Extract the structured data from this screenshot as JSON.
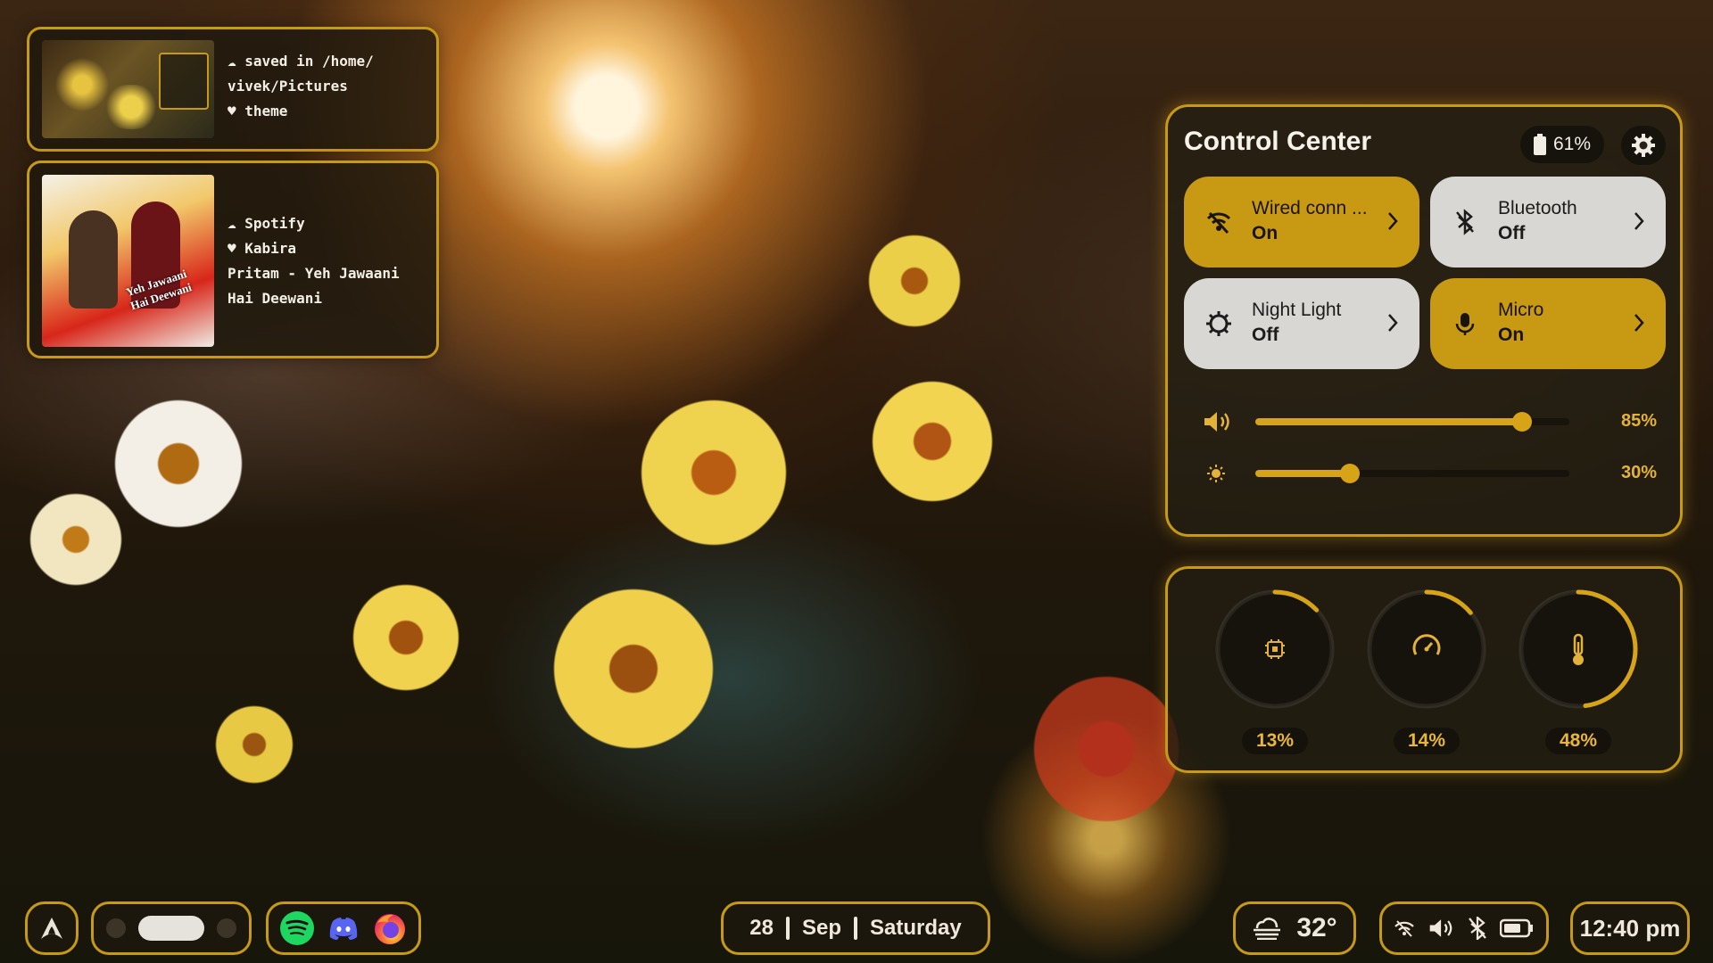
{
  "cards": [
    {
      "thumb": "screenshot-thumbnail",
      "line1": "☁ saved in /home/",
      "line2": "vivek/Pictures",
      "line3": "♥ theme"
    },
    {
      "thumb": "album-cover",
      "cover_title": "Yeh Jawaani Hai Deewani",
      "line1": "☁ Spotify",
      "line2": "♥ Kabira",
      "line3": "Pritam - Yeh Jawaani",
      "line4": "Hai Deewani"
    }
  ],
  "control_center": {
    "title": "Control Center",
    "battery": "61%",
    "tiles": [
      {
        "name": "Wired conn ...",
        "state": "On",
        "icon": "wifi-off-icon",
        "active": true
      },
      {
        "name": "Bluetooth",
        "state": "Off",
        "icon": "bluetooth-icon",
        "active": false
      },
      {
        "name": "Night Light",
        "state": "Off",
        "icon": "brightness-icon",
        "active": false
      },
      {
        "name": "Micro",
        "state": "On",
        "icon": "microphone-icon",
        "active": true
      }
    ],
    "volume": {
      "label": "85%",
      "value": 85
    },
    "brightness": {
      "label": "30%",
      "value": 30
    }
  },
  "system": {
    "cpu": {
      "label": "13%",
      "value": 13,
      "icon": "cpu-icon"
    },
    "ram": {
      "label": "14%",
      "value": 14,
      "icon": "speedometer-icon"
    },
    "temp": {
      "label": "48%",
      "value": 48,
      "icon": "thermometer-icon"
    }
  },
  "taskbar": {
    "launcher_icon": "arch-logo-icon",
    "apps": [
      "spotify-icon",
      "discord-icon",
      "firefox-icon"
    ],
    "date": {
      "day": "28",
      "month": "Sep",
      "weekday": "Saturday"
    },
    "weather": {
      "temp": "32°",
      "icon": "cloud-haze-icon"
    },
    "time": "12:40 pm"
  },
  "colors": {
    "accent": "#c69a17",
    "tile_on": "#c89912",
    "tile_off": "#d8d7d4"
  }
}
